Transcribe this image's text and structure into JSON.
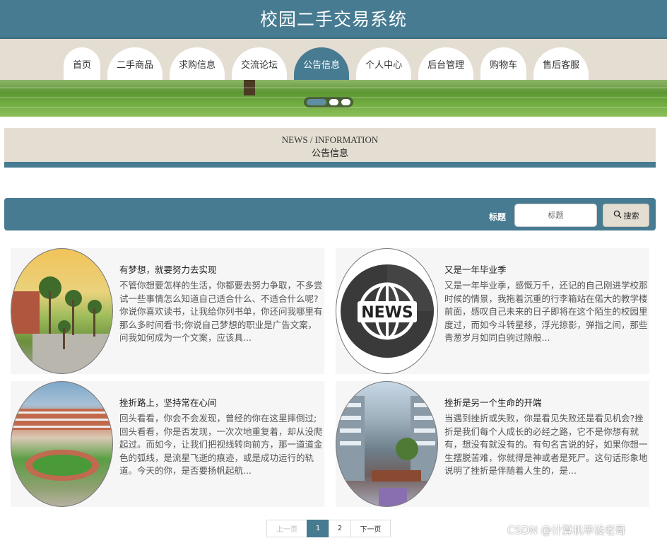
{
  "header": {
    "title": "校园二手交易系统"
  },
  "nav": {
    "items": [
      {
        "label": "首页"
      },
      {
        "label": "二手商品"
      },
      {
        "label": "求购信息"
      },
      {
        "label": "交流论坛"
      },
      {
        "label": "公告信息"
      },
      {
        "label": "个人中心"
      },
      {
        "label": "后台管理"
      },
      {
        "label": "购物车"
      },
      {
        "label": "售后客服"
      }
    ],
    "active": "公告信息"
  },
  "section": {
    "title_en": "NEWS / INFORMATION",
    "title_zh": "公告信息"
  },
  "search": {
    "label": "标题",
    "placeholder": "标题",
    "button_label": "搜索"
  },
  "news": [
    {
      "title": "有梦想，就要努力去实现",
      "summary": "不管你想要怎样的生活，你都要去努力争取，不多尝试一些事情怎么知道自己适合什么、不适合什么呢?你说你喜欢读书，让我给你列书单，你还问我哪里有那么多时间看书;你说自己梦想的职业是广告文案，问我如何成为一个文案，应该具..."
    },
    {
      "title": "又是一年毕业季",
      "summary": "又是一年毕业季，感慨万千，还记的自己刚进学校那时候的情景，我拖着沉重的行李箱站在偌大的教学楼前面，感叹自己未来的日子即将在这个陌生的校园里度过，而如今斗转星移，浮光掠影，弹指之间，那些青葱岁月如同白驹过隙般..."
    },
    {
      "title": "挫折路上，坚持常在心间",
      "summary": "回头看看，你会不会发现，曾经的你在这里摔倒过;回头看看，你是否发现，一次次地重复着，却从没爬起过。而如今，让我们把视线转向前方，那一道道金色的弧线，是流星飞逝的痕迹，或是成功运行的轨道。今天的你，是否要扬帆起航..."
    },
    {
      "title": "挫折是另一个生命的开端",
      "summary": "当遇到挫折或失败，你是看见失败还是看见机会?挫折是我们每个人成长的必经之路，它不是你想有就有，想没有就没有的。有句名言说的好，如果你想一生摆脱苦难，你就得是神或者是死尸。这句话形象地说明了挫折是伴随着人生的，是..."
    }
  ],
  "news_icon_text": "NEWS",
  "pagination": {
    "prev": "上一页",
    "pages": [
      "1",
      "2"
    ],
    "current": "1",
    "next": "下一页"
  },
  "watermark": "CSDN @计算机毕设老哥",
  "colors": {
    "primary": "#467b91",
    "beige": "#e4ddd2",
    "card_bg": "#f6f6f6"
  }
}
